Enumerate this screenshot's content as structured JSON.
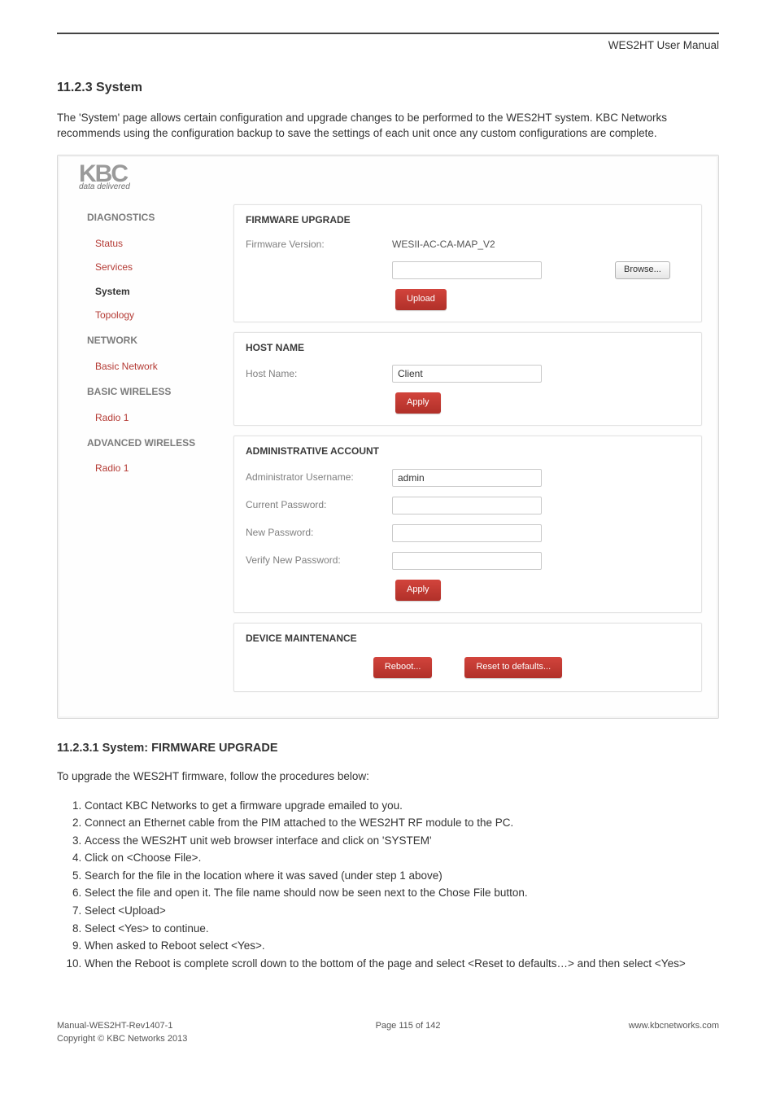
{
  "header": {
    "manual_title": "WES2HT User Manual"
  },
  "section": {
    "number_title": "11.2.3 System",
    "intro": "The 'System' page allows certain configuration and upgrade changes to be performed to the WES2HT system. KBC Networks recommends using the configuration backup to save the settings of each unit once any custom configurations are complete."
  },
  "screenshot": {
    "logo_letters": "KBC",
    "logo_tag": "data delivered",
    "nav": {
      "diagnostics": "DIAGNOSTICS",
      "status": "Status",
      "services": "Services",
      "system": "System",
      "topology": "Topology",
      "network": "NETWORK",
      "basic_network": "Basic Network",
      "basic_wireless": "BASIC WIRELESS",
      "radio1_a": "Radio 1",
      "advanced_wireless": "ADVANCED WIRELESS",
      "radio1_b": "Radio 1"
    },
    "firmware": {
      "title": "FIRMWARE UPGRADE",
      "label": "Firmware Version:",
      "value": "WESII-AC-CA-MAP_V2",
      "browse": "Browse...",
      "upload": "Upload"
    },
    "host": {
      "title": "HOST NAME",
      "label": "Host Name:",
      "value": "Client",
      "apply": "Apply"
    },
    "admin": {
      "title": "ADMINISTRATIVE ACCOUNT",
      "username_label": "Administrator Username:",
      "username_value": "admin",
      "curpw_label": "Current Password:",
      "newpw_label": "New Password:",
      "verpw_label": "Verify New Password:",
      "apply": "Apply"
    },
    "maint": {
      "title": "DEVICE MAINTENANCE",
      "reboot": "Reboot...",
      "reset": "Reset to defaults..."
    }
  },
  "sub": {
    "title": "11.2.3.1 System: FIRMWARE UPGRADE",
    "lead": "To upgrade the WES2HT firmware, follow the procedures below:",
    "steps": [
      "Contact KBC Networks to get a firmware upgrade emailed to you.",
      "Connect an Ethernet cable from the PIM attached to the WES2HT RF module to the PC.",
      "Access the WES2HT unit web browser interface and click on 'SYSTEM'",
      "Click on <Choose File>.",
      "Search for the file in the location where it was saved (under step 1 above)",
      "Select the file and open it. The file name should now be seen next to the Chose File button.",
      "Select <Upload>",
      "Select <Yes> to continue.",
      "When asked to Reboot select <Yes>.",
      "When the Reboot is complete scroll down to the bottom of the page and select <Reset to defaults…> and then select <Yes>"
    ]
  },
  "footer": {
    "left": "Manual-WES2HT-Rev1407-1\nCopyright © KBC Networks 2013",
    "center": "Page 115 of 142",
    "right": "www.kbcnetworks.com"
  }
}
